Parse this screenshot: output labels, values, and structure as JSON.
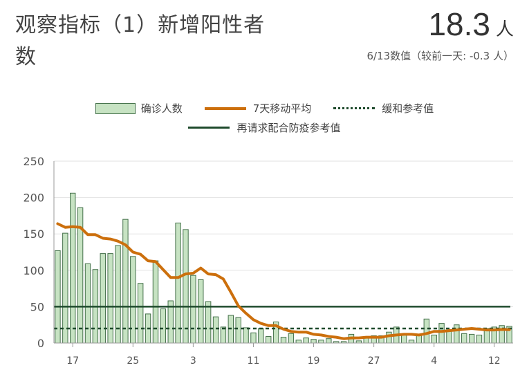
{
  "header": {
    "title": "观察指标（1）新增阳性者数",
    "value": "18.3",
    "unit": "人",
    "subtitle": "6/13数值（较前一天: -0.3 人）"
  },
  "colors": {
    "bar_fill": "#c7e3c3",
    "bar_stroke": "#44704a",
    "avg_line": "#cc6f0c",
    "mitigation_line": "#1e4a2c",
    "request_line": "#1e4a2c",
    "grid": "#e2e2e2"
  },
  "chart_data": {
    "type": "bar",
    "title": "观察指标（1）新增阳性者数",
    "ylim": [
      0,
      250
    ],
    "yticks": [
      0,
      50,
      100,
      150,
      200,
      250
    ],
    "grid": true,
    "legend_position": "top",
    "xtick_labels": [
      {
        "index": 2,
        "label": "17"
      },
      {
        "index": 10,
        "label": "25"
      },
      {
        "index": 18,
        "label": "3"
      },
      {
        "index": 26,
        "label": "11"
      },
      {
        "index": 34,
        "label": "19"
      },
      {
        "index": 42,
        "label": "27"
      },
      {
        "index": 50,
        "label": "4"
      },
      {
        "index": 58,
        "label": "12"
      }
    ],
    "series": [
      {
        "name": "确诊人数",
        "kind": "bar",
        "values": [
          127,
          151,
          206,
          186,
          109,
          101,
          123,
          123,
          134,
          170,
          119,
          82,
          40,
          113,
          47,
          58,
          165,
          156,
          93,
          87,
          57,
          36,
          22,
          38,
          35,
          21,
          14,
          20,
          9,
          29,
          8,
          13,
          4,
          7,
          5,
          4,
          6,
          2,
          2,
          12,
          3,
          7,
          10,
          10,
          15,
          22,
          11,
          4,
          12,
          33,
          11,
          27,
          18,
          25,
          13,
          12,
          11,
          20,
          22,
          24,
          23
        ]
      },
      {
        "name": "7天移动平均",
        "kind": "line",
        "values": [
          164,
          159,
          160,
          159,
          149,
          149,
          144,
          143,
          140,
          135,
          125,
          122,
          113,
          112,
          101,
          90,
          90,
          95,
          96,
          103,
          95,
          94,
          88,
          70,
          51,
          41,
          32,
          27,
          24,
          24,
          19,
          16,
          15,
          15,
          12,
          11,
          9,
          8,
          6,
          7,
          7,
          8,
          8,
          8,
          10,
          11,
          12,
          12,
          11,
          13,
          16,
          16,
          17,
          18,
          19,
          20,
          19,
          18,
          18,
          18.6,
          18.3
        ]
      },
      {
        "name": "缓和参考值",
        "kind": "reference",
        "value": 20
      },
      {
        "name": "再请求配合防疫参考值",
        "kind": "reference",
        "value": 50
      }
    ]
  }
}
